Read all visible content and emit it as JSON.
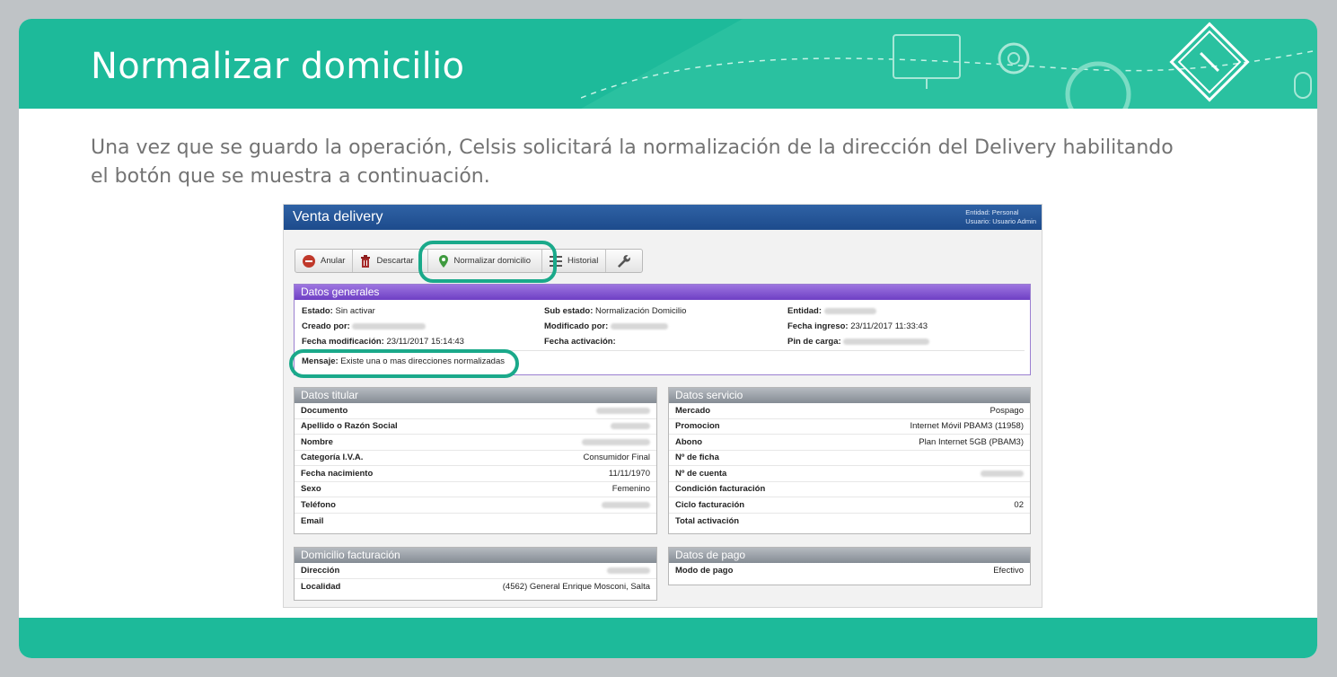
{
  "slide": {
    "title": "Normalizar domicilio",
    "intro": "Una vez que se guardo la operación, Celsis solicitará la normalización de la dirección del Delivery habilitando el botón que se muestra a continuación."
  },
  "app": {
    "title": "Venta delivery",
    "entity_line": "Entidad: Personal",
    "user_line": "Usuario: Usuario Admin",
    "toolbar": {
      "anular": "Anular",
      "descartar": "Descartar",
      "normalizar": "Normalizar domicilio",
      "historial": "Historial"
    },
    "general": {
      "header": "Datos generales",
      "estado_label": "Estado:",
      "estado_value": "Sin activar",
      "sub_estado_label": "Sub estado:",
      "sub_estado_value": "Normalización Domicilio",
      "entidad_label": "Entidad:",
      "creado_label": "Creado por:",
      "modificado_label": "Modificado por:",
      "fecha_ingreso_label": "Fecha ingreso:",
      "fecha_ingreso_value": "23/11/2017 11:33:43",
      "fecha_mod_label": "Fecha modificación:",
      "fecha_mod_value": "23/11/2017 15:14:43",
      "fecha_act_label": "Fecha activación:",
      "pin_label": "Pin de carga:",
      "mensaje_label": "Mensaje:",
      "mensaje_value": "Existe una o mas direcciones normalizadas"
    },
    "titular": {
      "header": "Datos titular",
      "rows": [
        {
          "k": "Documento",
          "v": ""
        },
        {
          "k": "Apellido o Razón Social",
          "v": ""
        },
        {
          "k": "Nombre",
          "v": ""
        },
        {
          "k": "Categoría I.V.A.",
          "v": "Consumidor Final"
        },
        {
          "k": "Fecha nacimiento",
          "v": "11/11/1970"
        },
        {
          "k": "Sexo",
          "v": "Femenino"
        },
        {
          "k": "Teléfono",
          "v": ""
        },
        {
          "k": "Email",
          "v": ""
        }
      ]
    },
    "servicio": {
      "header": "Datos servicio",
      "rows": [
        {
          "k": "Mercado",
          "v": "Pospago"
        },
        {
          "k": "Promocion",
          "v": "Internet Móvil PBAM3 (11958)"
        },
        {
          "k": "Abono",
          "v": "Plan Internet 5GB (PBAM3)"
        },
        {
          "k": "Nº de ficha",
          "v": ""
        },
        {
          "k": "Nº de cuenta",
          "v": ""
        },
        {
          "k": "Condición facturación",
          "v": ""
        },
        {
          "k": "Ciclo facturación",
          "v": "02"
        },
        {
          "k": "Total activación",
          "v": ""
        }
      ]
    },
    "domicilio": {
      "header": "Domicilio facturación",
      "rows": [
        {
          "k": "Dirección",
          "v": ""
        },
        {
          "k": "Localidad",
          "v": "(4562) General Enrique Mosconi, Salta"
        }
      ]
    },
    "pago": {
      "header": "Datos de pago",
      "rows": [
        {
          "k": "Modo de pago",
          "v": "Efectivo"
        }
      ]
    }
  }
}
